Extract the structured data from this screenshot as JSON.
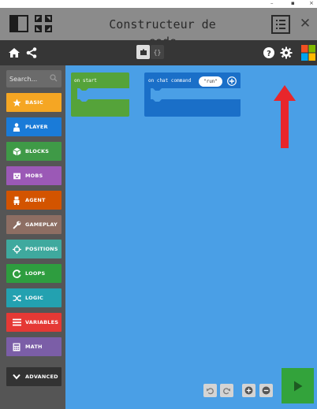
{
  "window": {
    "title": "Constructeur de code"
  },
  "toolbar": {
    "blocks_tab": "blocks-view",
    "code_tab": "{}"
  },
  "search": {
    "placeholder": "Search..."
  },
  "categories": [
    {
      "label": "BASIC",
      "color": "#f5a623",
      "icon": "star-icon"
    },
    {
      "label": "PLAYER",
      "color": "#1a7bd8",
      "icon": "person-icon"
    },
    {
      "label": "BLOCKS",
      "color": "#3f9a47",
      "icon": "cube-icon"
    },
    {
      "label": "MOBS",
      "color": "#9b59b6",
      "icon": "mob-icon"
    },
    {
      "label": "AGENT",
      "color": "#d35400",
      "icon": "agent-icon"
    },
    {
      "label": "GAMEPLAY",
      "color": "#8d6e63",
      "icon": "wrench-icon"
    },
    {
      "label": "POSITIONS",
      "color": "#3fa99e",
      "icon": "crosshair-icon"
    },
    {
      "label": "LOOPS",
      "color": "#2e9d3f",
      "icon": "loop-icon"
    },
    {
      "label": "LOGIC",
      "color": "#23a1b0",
      "icon": "shuffle-icon"
    },
    {
      "label": "VARIABLES",
      "color": "#e53935",
      "icon": "list-icon"
    },
    {
      "label": "MATH",
      "color": "#7b5ea7",
      "icon": "calculator-icon"
    },
    {
      "label": "ADVANCED",
      "color": "#333333",
      "icon": "chevron-down-icon"
    }
  ],
  "blocks": {
    "on_start": "on start",
    "on_chat": "on chat command",
    "chat_value": "\"run\""
  },
  "colors": {
    "titlebar": "#8b8b8b",
    "toolbar": "#363636",
    "workspace": "#4a9fe6",
    "sidebar": "#555555",
    "run": "#33a33b",
    "arrow": "#e8262b"
  }
}
